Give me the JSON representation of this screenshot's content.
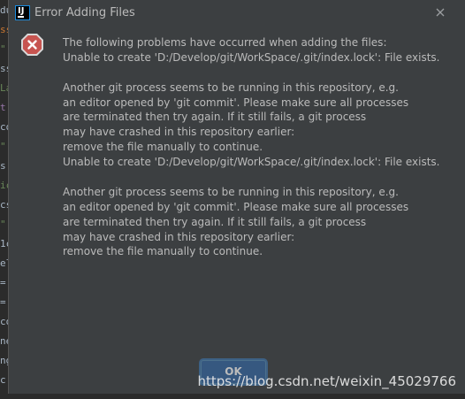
{
  "window": {
    "title": "Error Adding Files",
    "app_icon": "intellij-idea-icon",
    "close_icon": "close-icon"
  },
  "colors": {
    "dialog_background": "#3c3f41",
    "text": "#bbbbbb",
    "ok_button_background": "#365880",
    "error_icon_fill": "#c75450"
  },
  "error_icon": "error-x-icon",
  "message": {
    "lines": [
      "The following problems have occurred when adding the files:",
      "Unable to create 'D:/Develop/git/WorkSpace/.git/index.lock': File exists.",
      "",
      "Another git process seems to be running in this repository, e.g.",
      "an editor opened by 'git commit'. Please make sure all processes",
      "are terminated then try again. If it still fails, a git process",
      "may have crashed in this repository earlier:",
      "remove the file manually to continue.",
      "Unable to create 'D:/Develop/git/WorkSpace/.git/index.lock': File exists.",
      "",
      "Another git process seems to be running in this repository, e.g.",
      "an editor opened by 'git commit'. Please make sure all processes",
      "are terminated then try again. If it still fails, a git process",
      "may have crashed in this repository earlier:",
      "remove the file manually to continue."
    ]
  },
  "buttons": {
    "ok_label": "OK"
  },
  "watermark": "https://blog.csdn.net/weixin_45029766",
  "background_editor_fragments": [
    {
      "text": "du",
      "color": "#a9b7c6"
    },
    {
      "text": "ss",
      "color": "#cc7832"
    },
    {
      "text": "\"",
      "color": "#6a8759"
    },
    {
      "text": "ss",
      "color": "#a9b7c6"
    },
    {
      "text": "La",
      "color": "#6a8759"
    },
    {
      "text": "t",
      "color": "#9876aa"
    },
    {
      "text": "co",
      "color": "#a9b7c6"
    },
    {
      "text": "\"",
      "color": "#6a8759"
    },
    {
      "text": "s",
      "color": "#a9b7c6"
    },
    {
      "text": "ic",
      "color": "#6a8759"
    },
    {
      "text": "cs",
      "color": "#a9b7c6"
    },
    {
      "text": "\"",
      "color": "#6a8759"
    },
    {
      "text": "1c",
      "color": "#a9b7c6"
    },
    {
      "text": "el",
      "color": "#a9b7c6"
    },
    {
      "text": "=",
      "color": "#a9b7c6"
    },
    {
      "text": "=",
      "color": "#a9b7c6"
    },
    {
      "text": "co",
      "color": "#a9b7c6"
    },
    {
      "text": "ne",
      "color": "#a9b7c6"
    },
    {
      "text": "ng",
      "color": "#a9b7c6"
    },
    {
      "text": "c",
      "color": "#a9b7c6"
    }
  ]
}
